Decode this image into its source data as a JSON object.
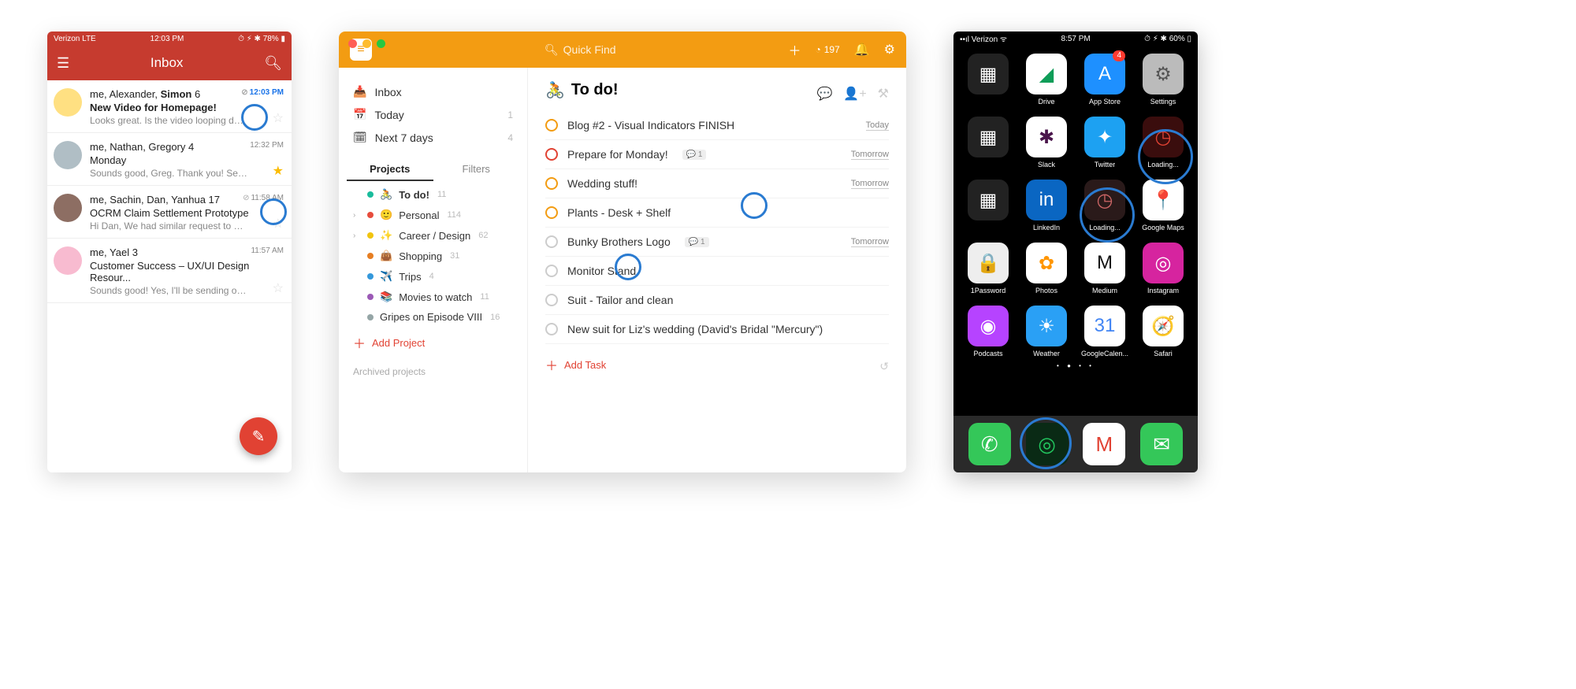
{
  "gmail": {
    "carrier": "Verizon  LTE",
    "time": "12:03 PM",
    "battery": "78%",
    "title": "Inbox",
    "compose_glyph": "✎",
    "emails": [
      {
        "from_html": "me, Alexander, <b>Simon</b>  6",
        "subject": "New Video for Homepage!",
        "subject_bold": true,
        "preview": "Looks great. Is the video looping done on th...",
        "time": "12:03 PM",
        "time_blue": true,
        "attach": true,
        "starred": false,
        "avatar_bg": "#ffe082"
      },
      {
        "from_html": "me, Nathan, Gregory  4",
        "subject": "Monday",
        "subject_bold": false,
        "preview": "Sounds good, Greg. Thank you! See you all ...",
        "time": "12:32 PM",
        "time_blue": false,
        "attach": false,
        "starred": true,
        "avatar_bg": "#b0bec5"
      },
      {
        "from_html": "me, Sachin, Dan, Yanhua  17",
        "subject": "OCRM Claim Settlement Prototype",
        "subject_bold": false,
        "preview": "Hi Dan, We had similar request to open IPM...",
        "time": "11:58 AM",
        "time_blue": false,
        "attach": true,
        "starred": false,
        "avatar_bg": "#8d6e63"
      },
      {
        "from_html": "me, Yael  3",
        "subject": "Customer Success – UX/UI Design Resour...",
        "subject_bold": false,
        "preview": "Sounds good! Yes, I'll be sending out my pe...",
        "time": "11:57 AM",
        "time_blue": false,
        "attach": false,
        "starred": false,
        "avatar_bg": "#f8bbd0"
      }
    ]
  },
  "todoist": {
    "quick_find": "Quick Find",
    "karma": "197",
    "nav": [
      {
        "icon": "📥",
        "label": "Inbox",
        "count": ""
      },
      {
        "icon": "📅",
        "label": "Today",
        "count": "1"
      },
      {
        "icon": "🗓",
        "label": "Next 7 days",
        "count": "4"
      }
    ],
    "tabs": {
      "projects": "Projects",
      "filters": "Filters"
    },
    "projects": [
      {
        "caret": "",
        "color": "#1abc9c",
        "emoji": "🚴",
        "label": "To do!",
        "bold": true,
        "count": "11"
      },
      {
        "caret": "›",
        "color": "#e74c3c",
        "emoji": "🙂",
        "label": "Personal",
        "count": "114"
      },
      {
        "caret": "›",
        "color": "#f1c40f",
        "emoji": "✨",
        "label": "Career / Design",
        "count": "62"
      },
      {
        "caret": "",
        "color": "#e67e22",
        "emoji": "👜",
        "label": "Shopping",
        "count": "31"
      },
      {
        "caret": "",
        "color": "#3498db",
        "emoji": "✈️",
        "label": "Trips",
        "count": "4"
      },
      {
        "caret": "",
        "color": "#9b59b6",
        "emoji": "📚",
        "label": "Movies to watch",
        "count": "11"
      },
      {
        "caret": "",
        "color": "#95a5a6",
        "emoji": "",
        "label": "Gripes on Episode VIII",
        "count": "16"
      }
    ],
    "add_project": "Add Project",
    "archived": "Archived projects",
    "list_title_emoji": "🚴",
    "list_title": "To do!",
    "tasks": [
      {
        "pri": "pri2",
        "text": "Blog #2 - Visual Indicators FINISH",
        "due": "Today",
        "underline": true,
        "comment": ""
      },
      {
        "pri": "pri1",
        "text": "Prepare for Monday!",
        "due": "Tomorrow",
        "underline": true,
        "comment": "1"
      },
      {
        "pri": "pri2",
        "text": "Wedding stuff!",
        "due": "Tomorrow",
        "underline": true,
        "comment": ""
      },
      {
        "pri": "pri2",
        "text": "Plants - Desk + Shelf",
        "due": "",
        "underline": false,
        "comment": ""
      },
      {
        "pri": "",
        "text": "Bunky Brothers Logo",
        "due": "Tomorrow",
        "underline": true,
        "comment": "1"
      },
      {
        "pri": "",
        "text": "Monitor Stand",
        "due": "",
        "underline": false,
        "comment": ""
      },
      {
        "pri": "",
        "text": "Suit - Tailor and clean",
        "due": "",
        "underline": false,
        "comment": ""
      },
      {
        "pri": "",
        "text": "New suit for Liz's wedding (David's Bridal \"Mercury\")",
        "due": "",
        "underline": false,
        "comment": ""
      }
    ],
    "add_task": "Add Task"
  },
  "ios": {
    "carrier": "Verizon",
    "time": "8:57 PM",
    "battery": "60%",
    "apps": [
      {
        "label": "",
        "bg": "#222",
        "glyph": "▦",
        "badge": ""
      },
      {
        "label": "Drive",
        "bg": "#fff",
        "glyph": "◢",
        "glyph_color": "#0f9d58",
        "badge": ""
      },
      {
        "label": "App Store",
        "bg": "#1e90ff",
        "glyph": "A",
        "badge": "4"
      },
      {
        "label": "Settings",
        "bg": "#bbb",
        "glyph": "⚙︎",
        "glyph_color": "#555",
        "badge": ""
      },
      {
        "label": "",
        "bg": "#222",
        "glyph": "▦",
        "badge": ""
      },
      {
        "label": "Slack",
        "bg": "#fff",
        "glyph": "✱",
        "glyph_color": "#4a154b",
        "badge": ""
      },
      {
        "label": "Twitter",
        "bg": "#1da1f2",
        "glyph": "✦",
        "badge": ""
      },
      {
        "label": "Loading...",
        "bg": "#3a0d0d",
        "glyph": "◷",
        "glyph_color": "#e14233",
        "badge": ""
      },
      {
        "label": "",
        "bg": "#222",
        "glyph": "▦",
        "badge": ""
      },
      {
        "label": "LinkedIn",
        "bg": "#0a66c2",
        "glyph": "in",
        "badge": ""
      },
      {
        "label": "Loading...",
        "bg": "#2a1a1a",
        "glyph": "◷",
        "glyph_color": "#c66",
        "badge": ""
      },
      {
        "label": "Google Maps",
        "bg": "#fff",
        "glyph": "📍",
        "badge": ""
      },
      {
        "label": "1Password",
        "bg": "#eee",
        "glyph": "🔒",
        "glyph_color": "#555",
        "badge": ""
      },
      {
        "label": "Photos",
        "bg": "#fff",
        "glyph": "✿",
        "glyph_color": "#ff9500",
        "badge": ""
      },
      {
        "label": "Medium",
        "bg": "#fff",
        "glyph": "M",
        "glyph_color": "#111",
        "badge": ""
      },
      {
        "label": "Instagram",
        "bg": "#d6249f",
        "glyph": "◎",
        "badge": ""
      },
      {
        "label": "Podcasts",
        "bg": "#b643ff",
        "glyph": "◉",
        "badge": ""
      },
      {
        "label": "Weather",
        "bg": "#2aa0f5",
        "glyph": "☀︎",
        "badge": ""
      },
      {
        "label": "GoogleCalen...",
        "bg": "#fff",
        "glyph": "31",
        "glyph_color": "#4285f4",
        "badge": ""
      },
      {
        "label": "Safari",
        "bg": "#fff",
        "glyph": "🧭",
        "badge": ""
      }
    ],
    "pager": "• ● • •",
    "dock": [
      {
        "name": "phone",
        "bg": "#34c759",
        "glyph": "✆"
      },
      {
        "name": "app2",
        "bg": "#0a2a15",
        "glyph": "◎",
        "glyph_color": "#22c55e"
      },
      {
        "name": "gmail",
        "bg": "#fff",
        "glyph": "M",
        "glyph_color": "#e14233"
      },
      {
        "name": "messages",
        "bg": "#34c759",
        "glyph": "✉︎"
      }
    ]
  }
}
